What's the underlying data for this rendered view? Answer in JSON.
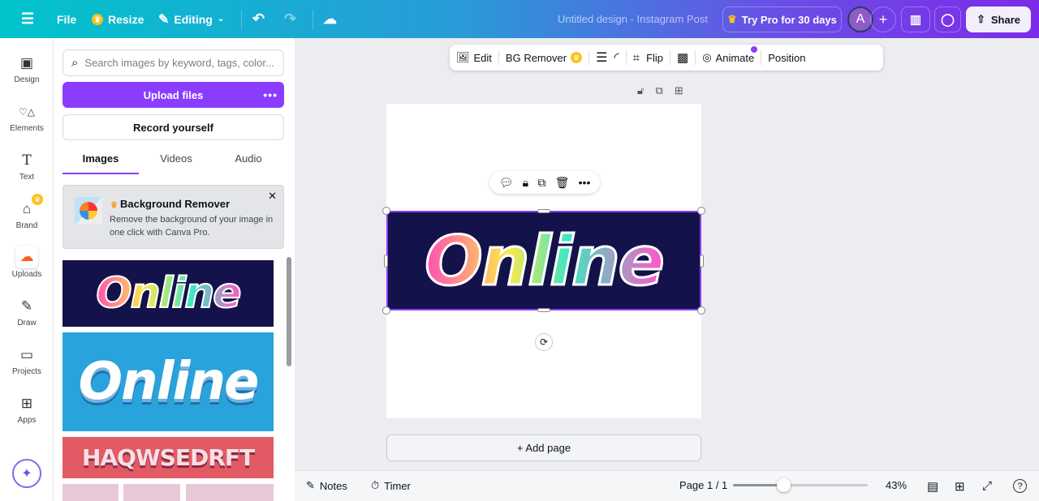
{
  "topbar": {
    "menu_icon": "hamburger-icon",
    "file": "File",
    "resize": "Resize",
    "editing": "Editing",
    "title": "Untitled design - Instagram Post",
    "try_pro": "Try Pro for 30 days",
    "avatar": "A",
    "share": "Share"
  },
  "rail": [
    {
      "label": "Design",
      "icon": "▣"
    },
    {
      "label": "Elements",
      "icon": "♡△"
    },
    {
      "label": "Text",
      "icon": "T"
    },
    {
      "label": "Brand",
      "icon": "⌂"
    },
    {
      "label": "Uploads",
      "icon": "☁"
    },
    {
      "label": "Draw",
      "icon": "✎"
    },
    {
      "label": "Projects",
      "icon": "▭"
    },
    {
      "label": "Apps",
      "icon": "⊞"
    }
  ],
  "panel": {
    "search_placeholder": "Search images by keyword, tags, color...",
    "upload": "Upload files",
    "record": "Record yourself",
    "tabs": [
      "Images",
      "Videos",
      "Audio"
    ],
    "promo": {
      "title": "Background Remover",
      "text": "Remove the background of your image in one click with Canva Pro."
    },
    "thumbs": [
      "Online",
      "Online",
      "HAQWSEDRFT"
    ]
  },
  "toolbar": {
    "edit": "Edit",
    "bg_remover": "BG Remover",
    "flip": "Flip",
    "animate": "Animate",
    "position": "Position"
  },
  "canvas": {
    "image_text": "Online",
    "add_page": "+ Add page"
  },
  "footer": {
    "notes": "Notes",
    "timer": "Timer",
    "page": "Page 1 / 1",
    "zoom": "43%",
    "zoom_value": 43,
    "help": "?"
  },
  "colors": {
    "accent": "#8b3dff",
    "teal": "#00c4cc"
  }
}
